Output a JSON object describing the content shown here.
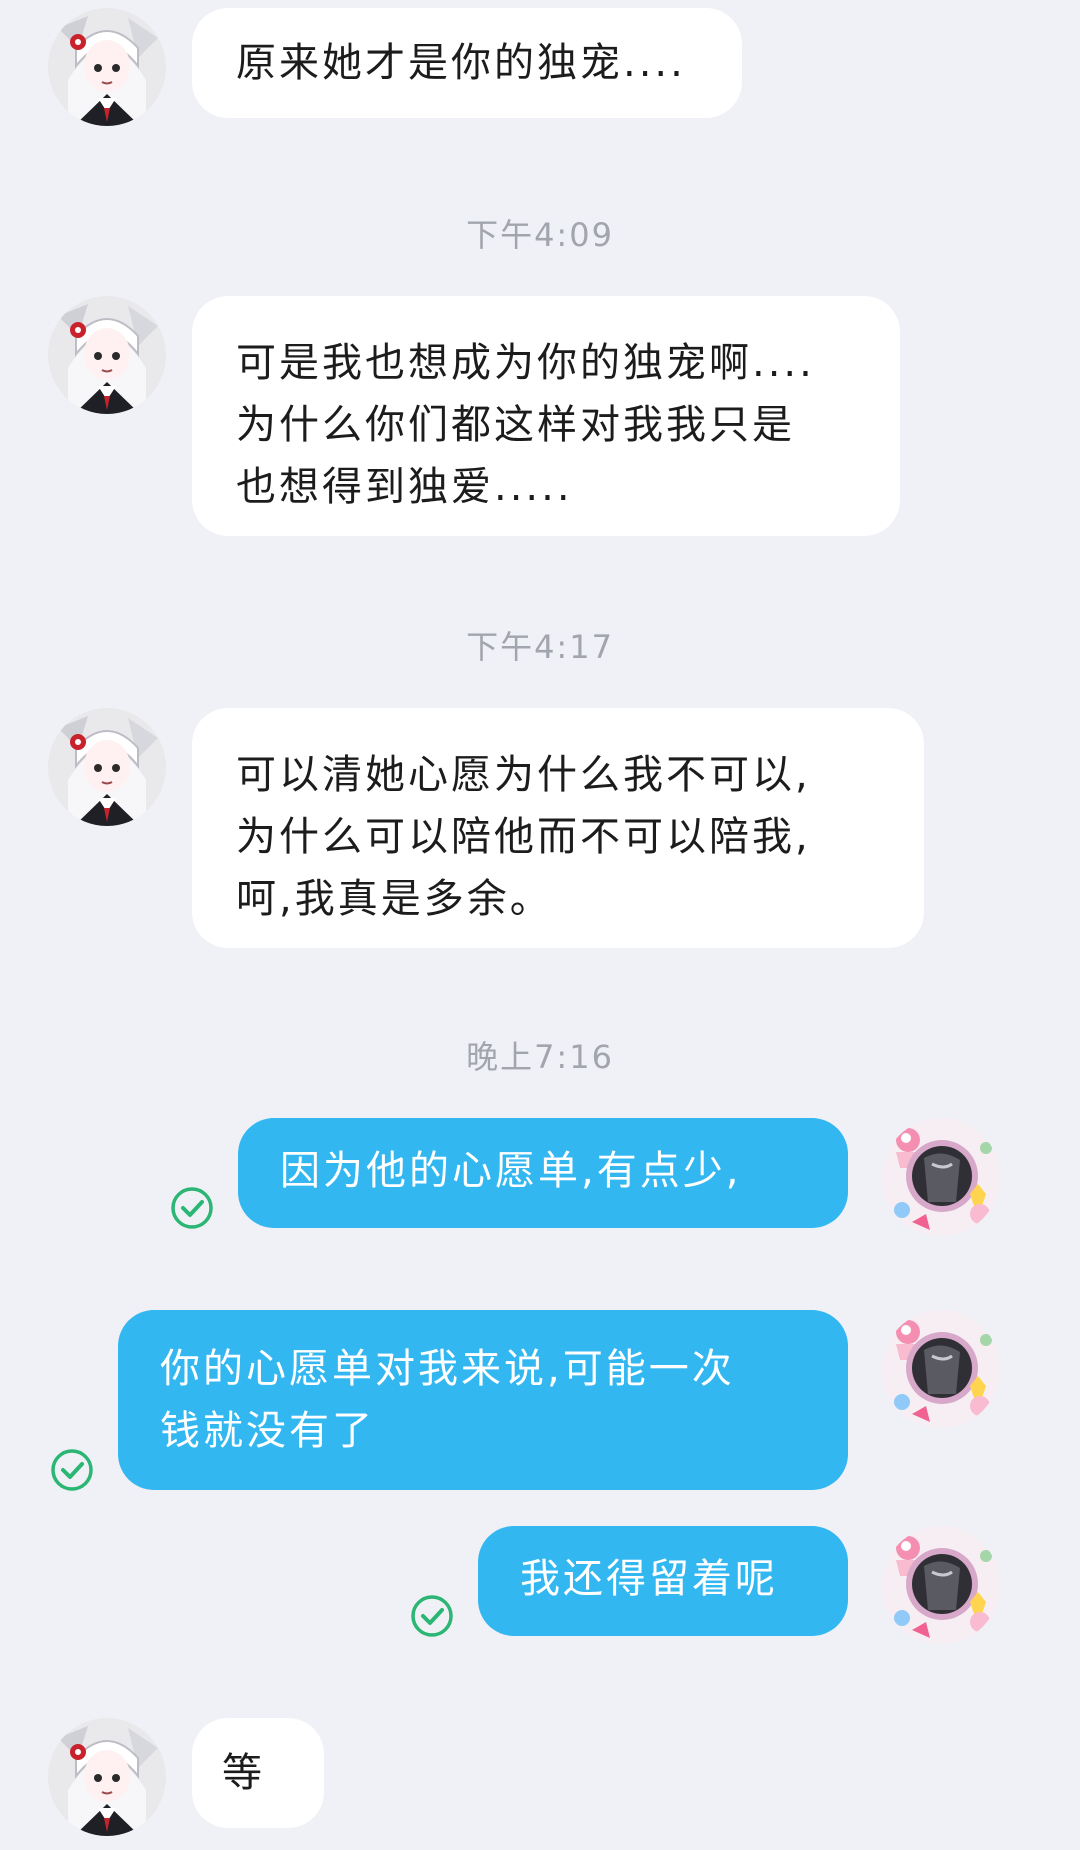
{
  "colors": {
    "background": "#f0f1f7",
    "incoming_bubble": "#ffffff",
    "outgoing_bubble": "#33b7f1",
    "read_check": "#2bb673",
    "timestamp_text": "#a2a5ad"
  },
  "icons": {
    "contact_avatar": "anime-girl-avatar",
    "my_avatar": "collage-avatar",
    "read_receipt": "check-circle-icon"
  },
  "messages": [
    {
      "sender": "contact",
      "text": "原来她才是你的独宠...."
    },
    {
      "timestamp": "下午4:09"
    },
    {
      "sender": "contact",
      "text": "可是我也想成为你的独宠啊....\n为什么你们都这样对我我只是\n也想得到独爱....."
    },
    {
      "timestamp": "下午4:17"
    },
    {
      "sender": "contact",
      "text": "可以清她心愿为什么我不可以,\n为什么可以陪他而不可以陪我,\n呵,我真是多余。"
    },
    {
      "timestamp": "晚上7:16"
    },
    {
      "sender": "me",
      "text": "因为他的心愿单,有点少,",
      "read": true
    },
    {
      "sender": "me",
      "text": "你的心愿单对我来说,可能一次\n钱就没有了",
      "read": true
    },
    {
      "sender": "me",
      "text": "我还得留着呢",
      "read": true
    },
    {
      "sender": "contact",
      "text": "等"
    }
  ]
}
